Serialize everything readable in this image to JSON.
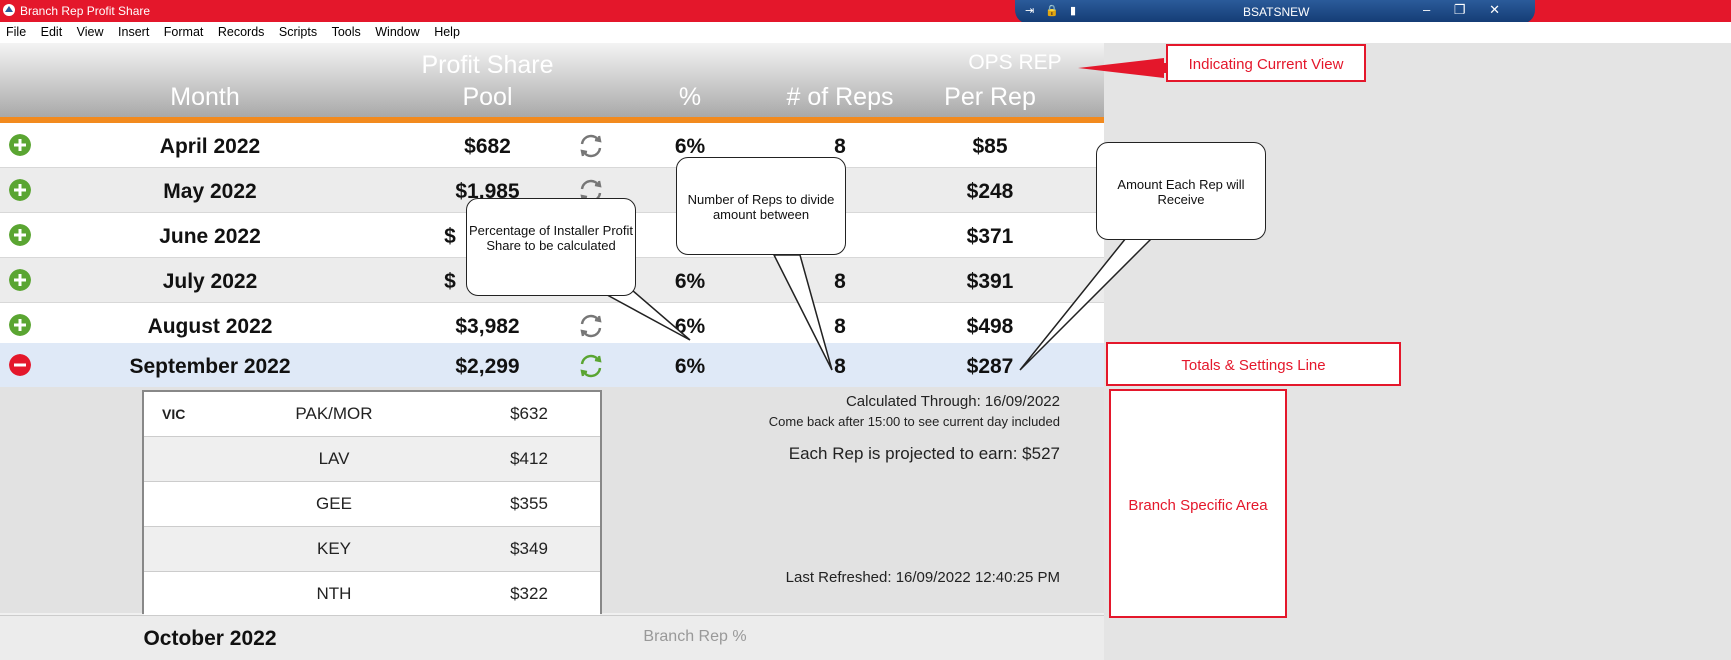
{
  "window": {
    "title": "Branch Rep Profit Share",
    "citrix_name": "BSATSNEW"
  },
  "menu": [
    "File",
    "Edit",
    "View",
    "Insert",
    "Format",
    "Records",
    "Scripts",
    "Tools",
    "Window",
    "Help"
  ],
  "header": {
    "month": "Month",
    "pool_line1": "Profit Share",
    "pool_line2": "Pool",
    "percent": "%",
    "reps": "# of Reps",
    "view": "OPS REP",
    "per_rep": "Per Rep"
  },
  "rows": [
    {
      "month": "April 2022",
      "pool": "$682",
      "percent": "6%",
      "reps": "8",
      "per_rep": "$85"
    },
    {
      "month": "May 2022",
      "pool": "$1,985",
      "percent": "",
      "reps": "",
      "per_rep": "$248"
    },
    {
      "month": "June 2022",
      "pool": "$",
      "percent": "",
      "reps": "",
      "per_rep": "$371"
    },
    {
      "month": "July 2022",
      "pool": "$",
      "percent": "6%",
      "reps": "8",
      "per_rep": "$391"
    },
    {
      "month": "August 2022",
      "pool": "$3,982",
      "percent": "6%",
      "reps": "8",
      "per_rep": "$498"
    },
    {
      "month": "September 2022",
      "pool": "$2,299",
      "percent": "6%",
      "reps": "8",
      "per_rep": "$287"
    }
  ],
  "branch": {
    "state": "VIC",
    "rows": [
      {
        "name": "PAK/MOR",
        "amount": "$632"
      },
      {
        "name": "LAV",
        "amount": "$412"
      },
      {
        "name": "GEE",
        "amount": "$355"
      },
      {
        "name": "KEY",
        "amount": "$349"
      },
      {
        "name": "NTH",
        "amount": "$322"
      }
    ]
  },
  "info": {
    "calculated": "Calculated Through: 16/09/2022",
    "comeback": "Come back after 15:00 to see current day included",
    "projected": "Each Rep is projected to earn: $527",
    "refreshed": "Last Refreshed: 16/09/2022 12:40:25 PM"
  },
  "next_row": {
    "month": "October 2022",
    "label": "Branch Rep %"
  },
  "annotations": {
    "current_view": "Indicating Current View",
    "percentage": "Percentage of Installer Profit Share to be calculated",
    "num_reps": "Number of Reps to divide amount between",
    "amount_each": "Amount Each Rep will Receive",
    "totals": "Totals & Settings Line",
    "branch_area": "Branch Specific Area"
  },
  "colors": {
    "titlebar": "#e4172b",
    "accent": "#f28a1e",
    "add": "#5aa532",
    "remove": "#e4172b",
    "selected_row": "#dfe9f7",
    "annotation": "#e4172b"
  }
}
